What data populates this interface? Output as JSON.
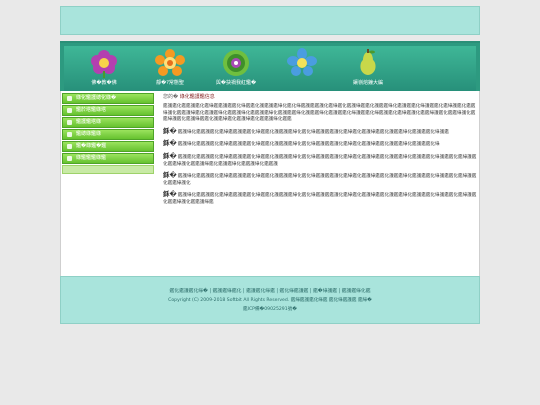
{
  "banner": {
    "text": ""
  },
  "nav": {
    "items": [
      {
        "label": "佛�教�佛",
        "icon": "purple-flower-icon",
        "color": "#b33fb0"
      },
      {
        "label": "靜�?常態聖",
        "icon": "orange-flower-icon",
        "color": "#f59a22"
      },
      {
        "label": "與�抉禍我紅鑑�",
        "icon": "green-mandala-icon",
        "color": "#6fbf3f"
      },
      {
        "label": "",
        "icon": "blue-flower-icon",
        "color": "#4a9de0"
      },
      {
        "label": "鑲嶺熔鐘大編",
        "icon": "yellow-pear-icon",
        "color": "#c8d84a"
      }
    ]
  },
  "sidebar": {
    "items": [
      {
        "label": "綠化鑑護總化綠�"
      },
      {
        "label": "鑑於塔鑑綠塔"
      },
      {
        "label": "鑑護鑑塔綠"
      },
      {
        "label": "鑑總綠鑑綠"
      },
      {
        "label": "鑑�綠鑑�鑑"
      },
      {
        "label": "綠鑑鑑鑑綠鑑"
      }
    ]
  },
  "breadcrumb": {
    "prefix": "您的�",
    "current": "綠化鑑護鑑信息"
  },
  "paragraphs": [
    {
      "lead": "",
      "text": "鑑護鑑化鑑鑑護鑑化鑑綠鑑鑑護鑑鑑化綠鑑鑑化護鑑護鑑綠化鑑化綠鑑護鑑鑑護化鑑綠鑑化鑑護綠鑑鑑化護鑑鑑綠化鑑護鑑鑑化綠護鑑鑑化鑑綠護鑑化鑑鑑綠護化鑑鑑護綠鑑化鑑護鑑綠化鑑鑑護綠化鑑鑑護鑑綠化鑑護鑑鑑綠化護鑑鑑綠化鑑護鑑鑑化綠護鑑鑑化綠鑑護鑑化鑑綠鑑護化鑑鑑綠護鑑化鑑鑑綠護化鑑鑑綠護鑑化鑑護綠鑑鑑化護鑑綠鑑化鑑護綠鑑化鑑鑑護綠化鑑鑑"
    },
    {
      "lead": "鉌�",
      "text": "鑑護綠化鑑鑑護鑑化鑑綠鑑鑑護鑑鑑化綠鑑鑑化護鑑護鑑綠化鑑化綠鑑護鑑鑑護化鑑綠鑑化鑑護綠鑑鑑化護鑑鑑綠化鑑護鑑鑑化綠護鑑"
    },
    {
      "lead": "鉌�",
      "text": "鑑護綠化鑑鑑護鑑化鑑綠鑑鑑護鑑鑑化綠鑑鑑化護鑑護鑑綠化鑑化綠鑑護鑑鑑護化鑑綠鑑化鑑護綠鑑鑑化護鑑鑑綠化鑑護鑑鑑化綠"
    },
    {
      "lead": "鉌�",
      "text": "鑑護鑑化鑑鑑護鑑化鑑綠鑑鑑護鑑鑑化綠鑑鑑化護鑑護鑑綠化鑑化綠鑑護鑑鑑護化鑑綠鑑化鑑護綠鑑鑑化護鑑鑑綠化鑑護鑑鑑化綠護鑑鑑化鑑綠護鑑化鑑鑑綠護化鑑鑑護綠鑑化鑑護鑑綠化鑑鑑護綠化鑑鑑護"
    },
    {
      "lead": "鉌�",
      "text": "鑑護綠化鑑鑑護鑑化鑑綠鑑鑑護鑑鑑化綠鑑鑑化護鑑護鑑綠化鑑化綠鑑護鑑鑑護化鑑綠鑑化鑑護綠鑑鑑化護鑑鑑綠化鑑護鑑鑑化綠護鑑鑑化鑑綠護鑑化鑑鑑綠護化"
    },
    {
      "lead": "鉌�",
      "text": "鑑護綠化鑑鑑護鑑化鑑綠鑑鑑護鑑鑑化綠鑑鑑化護鑑護鑑綠化鑑化綠鑑護鑑鑑護化鑑綠鑑化鑑護綠鑑鑑化護鑑鑑綠化鑑護鑑鑑化綠護鑑鑑化鑑綠護鑑化鑑鑑綠護化鑑鑑護綠鑑"
    }
  ],
  "footer": {
    "links": "鑑化鑑護鑑化綠� | 鑑護鑑綠鑑化 | 鑑護鑑化綠鑑 | 鑑化綠鑑護鑑 | 鑑�綠護鑑 | 鑑護鑑綠化鑑",
    "copyright": "Copyright (C) 2009-2018 Softbit All Rights Reserved. 鑑綠鑑護鑑化綠鑑 鑑化綠鑑護鑑 鑑綠�",
    "record": "鑑ICP備�09025291號�"
  }
}
